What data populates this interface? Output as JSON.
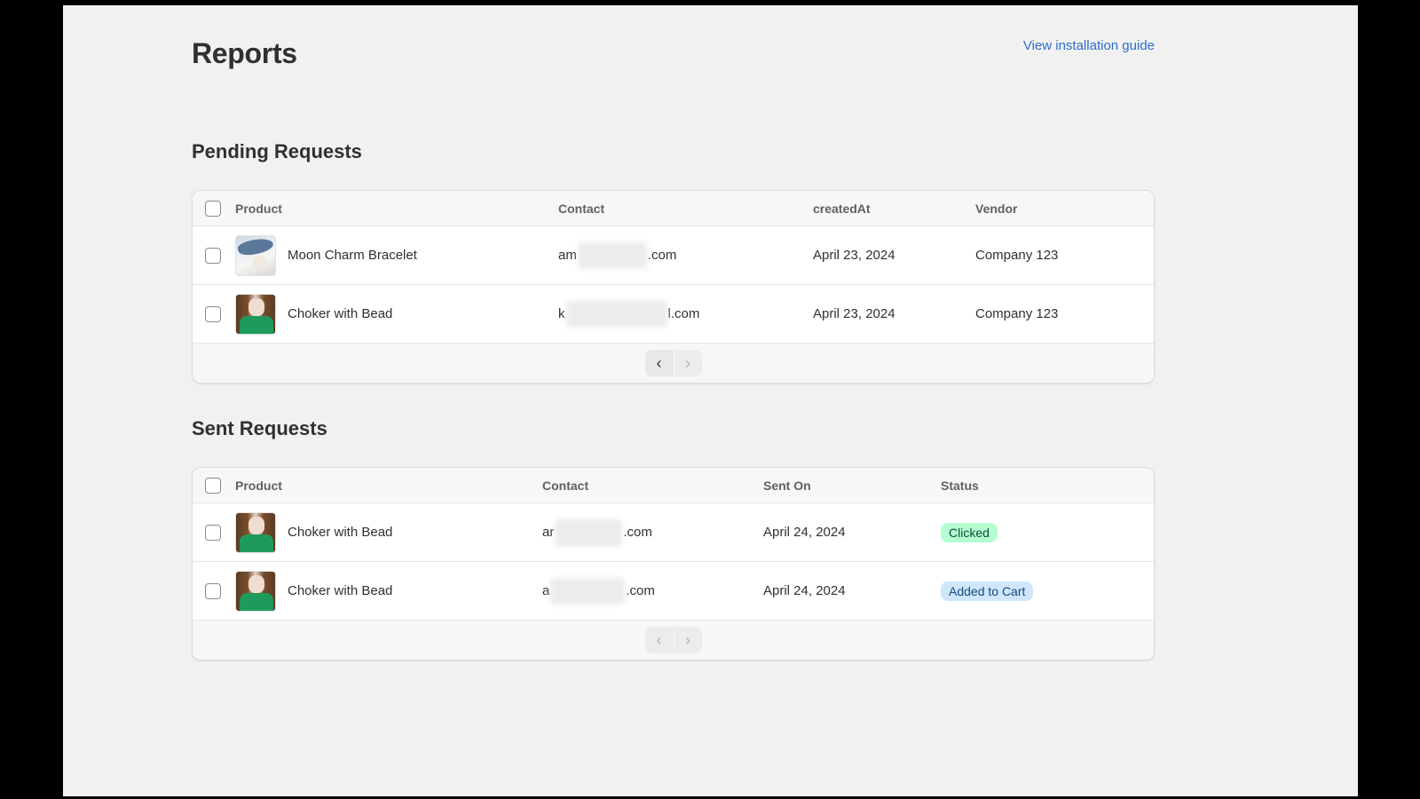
{
  "page": {
    "title": "Reports",
    "guide_link": "View installation guide"
  },
  "pending": {
    "title": "Pending Requests",
    "columns": [
      "Product",
      "Contact",
      "createdAt",
      "Vendor"
    ],
    "rows": [
      {
        "product": "Moon Charm Bracelet",
        "thumb": "bracelet-photo",
        "contact_start": "am",
        "contact_end": ".com",
        "created_at": "April 23, 2024",
        "vendor": "Company 123"
      },
      {
        "product": "Choker with Bead",
        "thumb": "choker-photo",
        "contact_start": "k",
        "contact_end": "l.com",
        "created_at": "April 23, 2024",
        "vendor": "Company 123"
      }
    ]
  },
  "sent": {
    "title": "Sent Requests",
    "columns": [
      "Product",
      "Contact",
      "Sent On",
      "Status"
    ],
    "rows": [
      {
        "product": "Choker with Bead",
        "thumb": "choker-photo",
        "contact_start": "ar",
        "contact_end": ".com",
        "sent_on": "April 24, 2024",
        "status": "Clicked",
        "status_color": "#b4fed2"
      },
      {
        "product": "Choker with Bead",
        "thumb": "choker-photo",
        "contact_start": "a",
        "contact_end": ".com",
        "sent_on": "April 24, 2024",
        "status": "Added to Cart",
        "status_color": "#cfe6fb"
      }
    ]
  },
  "pagination": {
    "prev": "‹",
    "next": "›"
  },
  "icons": [
    "checkbox-icon",
    "chevron-left-icon",
    "chevron-right-icon"
  ]
}
